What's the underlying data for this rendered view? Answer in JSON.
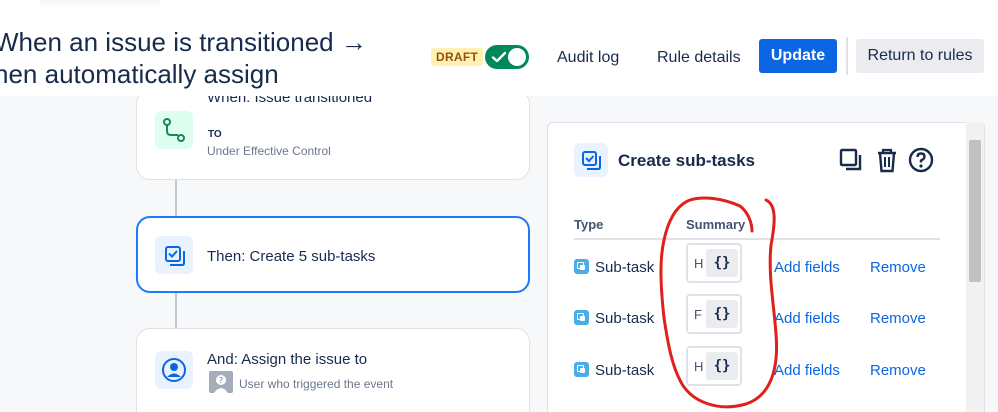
{
  "header": {
    "title_line1": "When an issue is transitioned →",
    "title_line2": "hen automatically assign",
    "status_badge": "DRAFT",
    "toggle_enabled": true,
    "audit_log": "Audit log",
    "rule_details": "Rule details",
    "update": "Update",
    "return_to_rules": "Return to rules"
  },
  "flow": {
    "trigger": {
      "title": "When: Issue transitioned",
      "to_label": "TO",
      "status": "Under Effective Control"
    },
    "action": {
      "title": "Then: Create 5 sub-tasks"
    },
    "assign": {
      "title": "And: Assign the issue to",
      "assignee": "User who triggered the event"
    }
  },
  "panel": {
    "title": "Create sub-tasks",
    "columns": {
      "type": "Type",
      "summary": "Summary"
    },
    "rows": [
      {
        "type": "Sub-task",
        "summary_char": "H",
        "smart_value": "{}",
        "add_fields": "Add fields",
        "remove": "Remove"
      },
      {
        "type": "Sub-task",
        "summary_char": "F",
        "smart_value": "{}",
        "add_fields": "Add fields",
        "remove": "Remove"
      },
      {
        "type": "Sub-task",
        "summary_char": "H",
        "smart_value": "{}",
        "add_fields": "Add fields",
        "remove": "Remove"
      }
    ]
  },
  "colors": {
    "primary": "#0c66e4",
    "success": "#00875a",
    "draft_bg": "#fff0b3",
    "draft_fg": "#974f0c",
    "annotation": "#e0201b"
  }
}
